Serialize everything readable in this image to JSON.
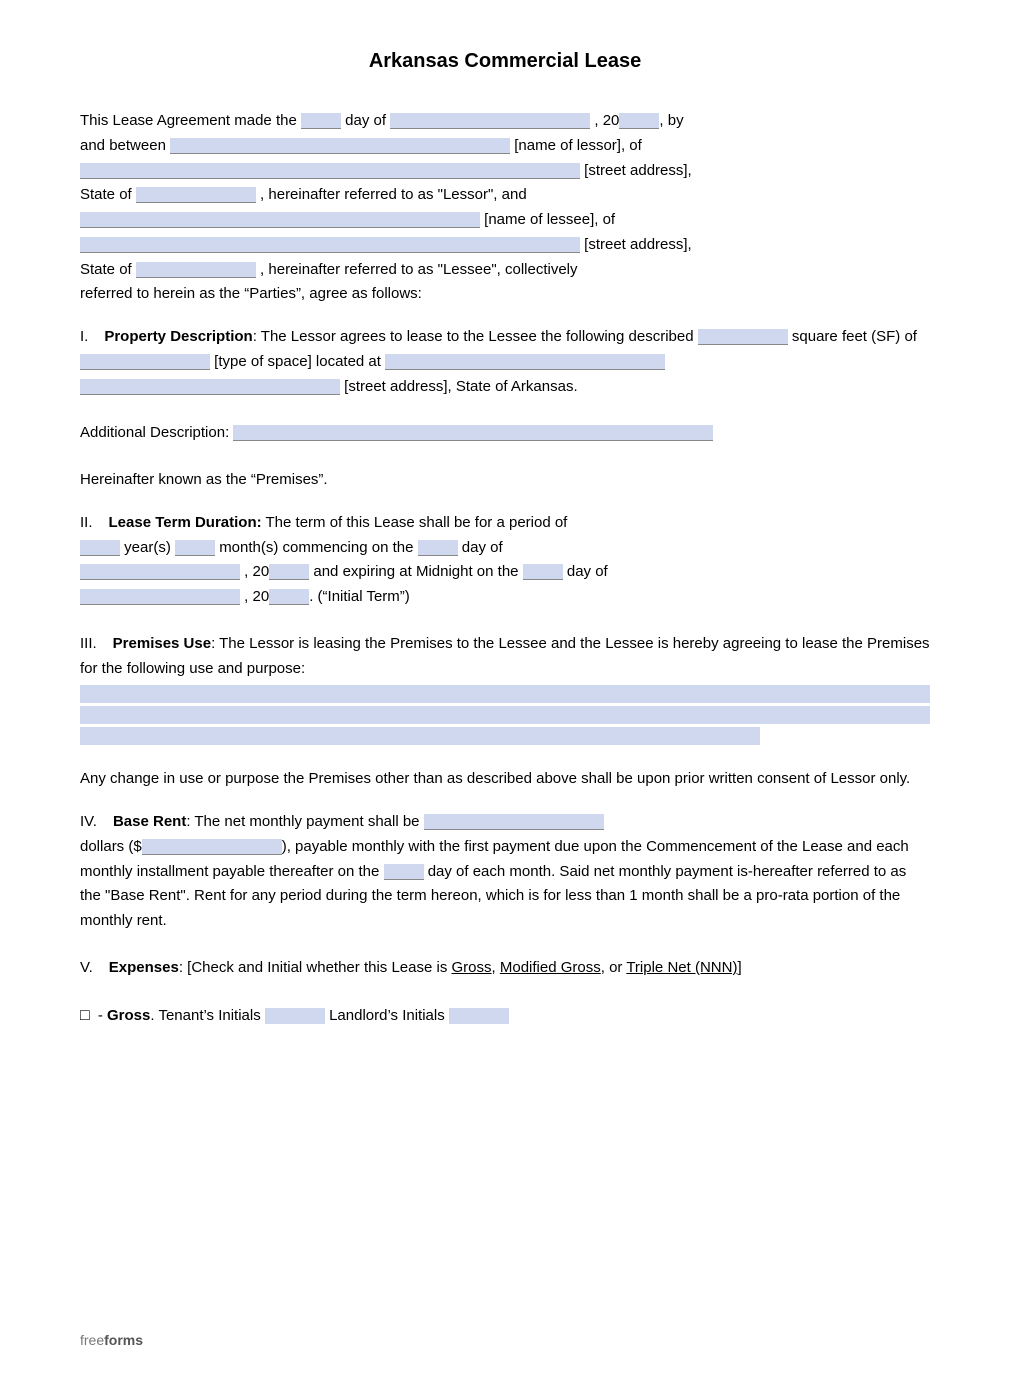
{
  "title": "Arkansas Commercial Lease",
  "intro": {
    "line1_pre": "This Lease Agreement made the",
    "line1_post": "day of",
    "line1_year_pre": ", 20",
    "line1_year_post": ", by",
    "line2_pre": "and between",
    "line2_post": "[name of lessor], of",
    "line3_post": "[street address],",
    "line4_pre": "State of",
    "line4_post": ", hereinafter referred to as \"Lessor\", and",
    "line5_post": "[name of lessee], of",
    "line6_post": "[street address],",
    "line7_pre": "State of",
    "line7_post": ", hereinafter referred to as \"Lessee\", collectively",
    "line8": "referred to herein as the “Parties”, agree as follows:"
  },
  "sections": {
    "I": {
      "num": "I.",
      "title": "Property Description",
      "text1": ": The Lessor agrees to lease to the Lessee the following described",
      "text2": "square feet (SF) of",
      "text3": "[type of space] located at",
      "text4": "[street address], State of Arkansas."
    },
    "additional_desc": {
      "label": "Additional Description:",
      "note": "Hereinafter known as the “Premises”."
    },
    "II": {
      "num": "II.",
      "title": "Lease Term Duration:",
      "text1": "The term of this Lease shall be for a period of",
      "text2": "year(s)",
      "text3": "month(s) commencing on the",
      "text4": "day of",
      "text5": ", 20",
      "text6": "and expiring at Midnight on the",
      "text7": "day of",
      "text8": ", 20",
      "text9": ". (“Initial Term”)"
    },
    "III": {
      "num": "III.",
      "title": "Premises Use",
      "text1": ": The Lessor is leasing the Premises to the Lessee and the Lessee is hereby agreeing to lease the Premises for the following use and purpose:"
    },
    "use_change": "Any change in use or purpose the Premises other than as described above shall be upon prior written consent of Lessor only.",
    "IV": {
      "num": "IV.",
      "title": "Base Rent",
      "text1": ": The net monthly payment shall be",
      "text2": "dollars ($",
      "text3": "), payable monthly with the first payment due upon the Commencement of the Lease and each monthly installment payable thereafter on the",
      "text4": "day of each month. Said net monthly payment is-hereafter referred to as the \"Base Rent\". Rent for any period during the term hereon, which is for less than 1 month shall be a pro-rata portion of the monthly rent."
    },
    "V": {
      "num": "V.",
      "title": "Expenses",
      "text1": ": [Check and Initial whether this Lease is",
      "gross_label": "Gross",
      "text2": ",",
      "modified_label": "Modified Gross",
      "text3": ", or",
      "triple_label": "Triple Net (NNN)",
      "text4": "]"
    },
    "gross_option": {
      "checkbox": "□",
      "dash": "- ",
      "label": "Gross",
      "tenants_initials": "Tenant’s Initials",
      "landlords_initials": "Landlord’s Initials"
    }
  },
  "footer": {
    "free": "free",
    "forms": "forms"
  }
}
